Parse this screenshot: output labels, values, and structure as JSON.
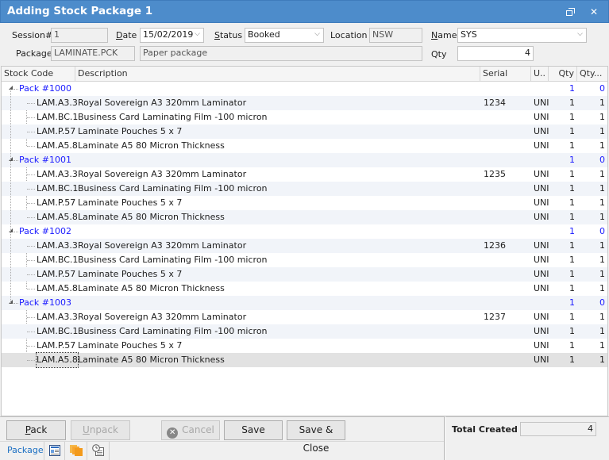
{
  "window": {
    "title": "Adding Stock Package 1",
    "restore_label": "restore",
    "close_label": "✕"
  },
  "header": {
    "session_label": "Session#",
    "session_value": "1",
    "date_label": "Date",
    "date_value": "15/02/2019",
    "status_label": "Status",
    "status_value": "Booked",
    "location_label": "Location",
    "location_value": "NSW",
    "name_label": "Name",
    "name_value": "SYS",
    "package_label": "Package",
    "package_code": "LAMINATE.PCK",
    "package_description": "Paper package",
    "qty_label": "Qty",
    "qty_value": "4"
  },
  "grid": {
    "columns": [
      "Stock Code",
      "Description",
      "Serial",
      "U..",
      "Qty",
      "Qty..."
    ],
    "packs": [
      {
        "label": "Pack #1000",
        "qty": "1",
        "qty2": "0",
        "items": [
          {
            "code": "LAM.A3.3",
            "description": "Royal Sovereign A3 320mm Laminator",
            "serial": "1234",
            "unit": "UNI",
            "qty": "1",
            "qty2": "1"
          },
          {
            "code": "LAM.BC.1",
            "description": "Business Card Laminating Film -100 micron",
            "serial": "",
            "unit": "UNI",
            "qty": "1",
            "qty2": "1"
          },
          {
            "code": "LAM.P.57",
            "description": "Laminate Pouches 5 x 7",
            "serial": "",
            "unit": "UNI",
            "qty": "1",
            "qty2": "1"
          },
          {
            "code": "LAM.A5.8",
            "description": "Laminate A5 80 Micron Thickness",
            "serial": "",
            "unit": "UNI",
            "qty": "1",
            "qty2": "1"
          }
        ]
      },
      {
        "label": "Pack #1001",
        "qty": "1",
        "qty2": "0",
        "items": [
          {
            "code": "LAM.A3.3",
            "description": "Royal Sovereign A3 320mm Laminator",
            "serial": "1235",
            "unit": "UNI",
            "qty": "1",
            "qty2": "1"
          },
          {
            "code": "LAM.BC.1",
            "description": "Business Card Laminating Film -100 micron",
            "serial": "",
            "unit": "UNI",
            "qty": "1",
            "qty2": "1"
          },
          {
            "code": "LAM.P.57",
            "description": "Laminate Pouches 5 x 7",
            "serial": "",
            "unit": "UNI",
            "qty": "1",
            "qty2": "1"
          },
          {
            "code": "LAM.A5.8",
            "description": "Laminate A5 80 Micron Thickness",
            "serial": "",
            "unit": "UNI",
            "qty": "1",
            "qty2": "1"
          }
        ]
      },
      {
        "label": "Pack #1002",
        "qty": "1",
        "qty2": "0",
        "items": [
          {
            "code": "LAM.A3.3",
            "description": "Royal Sovereign A3 320mm Laminator",
            "serial": "1236",
            "unit": "UNI",
            "qty": "1",
            "qty2": "1"
          },
          {
            "code": "LAM.BC.1",
            "description": "Business Card Laminating Film -100 micron",
            "serial": "",
            "unit": "UNI",
            "qty": "1",
            "qty2": "1"
          },
          {
            "code": "LAM.P.57",
            "description": "Laminate Pouches 5 x 7",
            "serial": "",
            "unit": "UNI",
            "qty": "1",
            "qty2": "1"
          },
          {
            "code": "LAM.A5.8",
            "description": "Laminate A5 80 Micron Thickness",
            "serial": "",
            "unit": "UNI",
            "qty": "1",
            "qty2": "1"
          }
        ]
      },
      {
        "label": "Pack #1003",
        "qty": "1",
        "qty2": "0",
        "items": [
          {
            "code": "LAM.A3.3",
            "description": "Royal Sovereign A3 320mm Laminator",
            "serial": "1237",
            "unit": "UNI",
            "qty": "1",
            "qty2": "1"
          },
          {
            "code": "LAM.BC.1",
            "description": "Business Card Laminating Film -100 micron",
            "serial": "",
            "unit": "UNI",
            "qty": "1",
            "qty2": "1"
          },
          {
            "code": "LAM.P.57",
            "description": "Laminate Pouches 5 x 7",
            "serial": "",
            "unit": "UNI",
            "qty": "1",
            "qty2": "1"
          },
          {
            "code": "LAM.A5.8",
            "description": "Laminate A5 80 Micron Thickness",
            "serial": "",
            "unit": "UNI",
            "qty": "1",
            "qty2": "1"
          }
        ]
      }
    ]
  },
  "footer": {
    "pack_label": "Pack",
    "unpack_label": "Unpack",
    "cancel_label": "Cancel",
    "save_label": "Save",
    "save_close_label": "Save & Close",
    "total_created_label": "Total Created",
    "total_created_value": "4",
    "tabs": [
      {
        "label": "Package",
        "icon": "package-tab"
      },
      {
        "label": "",
        "icon": "details-icon"
      },
      {
        "label": "",
        "icon": "documents-icon"
      },
      {
        "label": "",
        "icon": "history-icon"
      }
    ]
  },
  "colors": {
    "titlebar": "#4d8ccb",
    "pack_text": "#1a1aff",
    "tab_active": "#1b6fc2",
    "selected_row": "#e2e2e2",
    "alt_row": "#f1f4f9"
  }
}
